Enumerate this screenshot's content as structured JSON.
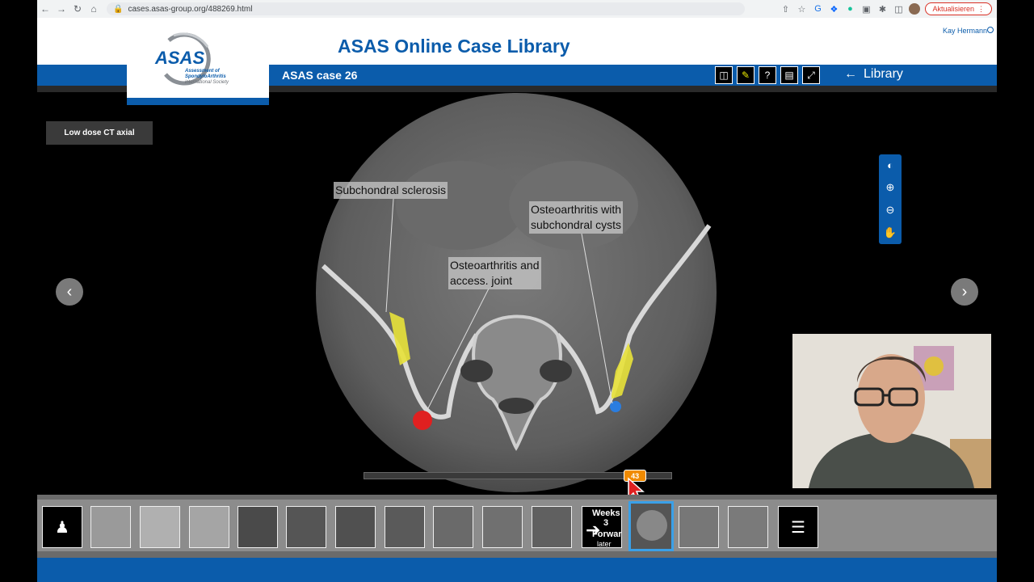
{
  "browser": {
    "url": "cases.asas-group.org/488269.html",
    "update_label": "Aktualisieren"
  },
  "header": {
    "site_title": "ASAS Online Case Library",
    "user_name": "Kay Hermann",
    "logo_text": "ASAS",
    "logo_sub_lines": [
      "Assessment of",
      "SpondyloArthritis",
      "international Society"
    ],
    "case_title": "ASAS case 26",
    "library_label": "Library"
  },
  "viewer": {
    "series_label": "Low dose CT axial",
    "annotations": {
      "sclerosis": "Subchondral sclerosis",
      "cysts_line1": "Osteoarthritis with",
      "cysts_line2": "subchondral cysts",
      "access_line1": "Osteoarthritis and",
      "access_line2": "access. joint"
    },
    "slice_number": "43",
    "slice_fraction": 0.88
  },
  "thumbnails": {
    "weeks_label_1": "Weeks",
    "weeks_label_2": "3",
    "forward_label": "Forward",
    "later_label": "later"
  },
  "colors": {
    "brand_blue": "#0b5cab",
    "slider_orange": "#f08a00",
    "annotation_yellow": "#e8e23a",
    "marker_red": "#e02020",
    "marker_blue": "#2a7de0"
  }
}
